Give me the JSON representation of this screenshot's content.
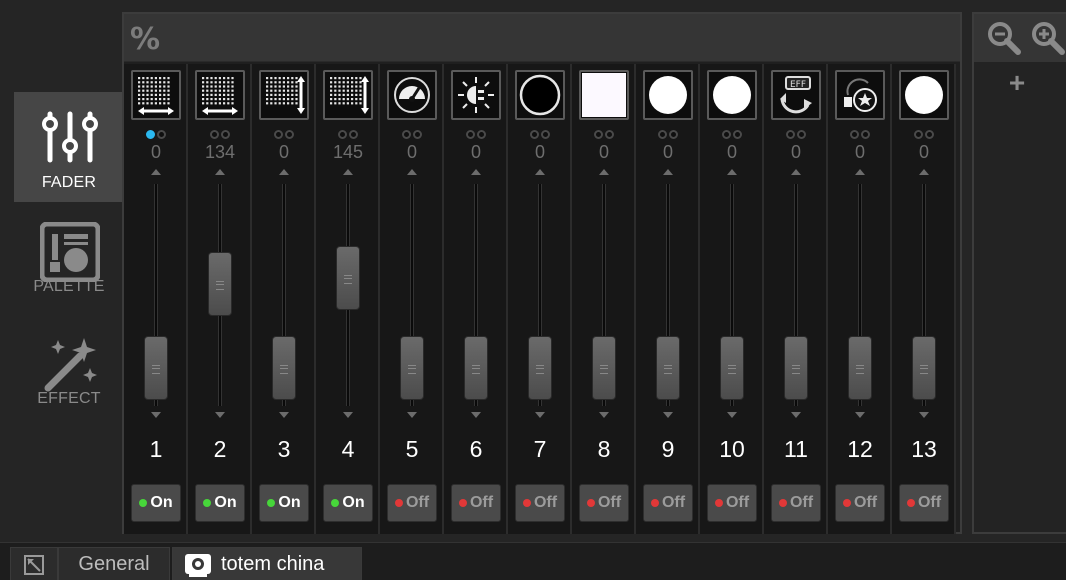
{
  "modes": [
    {
      "id": "fader",
      "label": "FADER",
      "active": true,
      "icon": "sliders-icon"
    },
    {
      "id": "palette",
      "label": "PALETTE",
      "active": false,
      "icon": "palette-icon"
    },
    {
      "id": "effect",
      "label": "EFFECT",
      "active": false,
      "icon": "magic-wand-icon"
    }
  ],
  "panel": {
    "header_icon": "percent-icon"
  },
  "strips": [
    {
      "number": "1",
      "value": "0",
      "fader_level": 0,
      "thumb": "grid-horizontal-icon",
      "dot_active": true,
      "state": "On"
    },
    {
      "number": "2",
      "value": "134",
      "fader_level": 0.53,
      "thumb": "grid-horizontal-icon",
      "dot_active": false,
      "state": "On"
    },
    {
      "number": "3",
      "value": "0",
      "fader_level": 0,
      "thumb": "grid-vertical-icon",
      "dot_active": false,
      "state": "On"
    },
    {
      "number": "4",
      "value": "145",
      "fader_level": 0.57,
      "thumb": "grid-vertical-icon",
      "dot_active": false,
      "state": "On"
    },
    {
      "number": "5",
      "value": "0",
      "fader_level": 0,
      "thumb": "dimmer-gauge-icon",
      "dot_active": false,
      "state": "Off"
    },
    {
      "number": "6",
      "value": "0",
      "fader_level": 0,
      "thumb": "shutter-icon",
      "dot_active": false,
      "state": "Off"
    },
    {
      "number": "7",
      "value": "0",
      "fader_level": 0,
      "thumb": "color-black-icon",
      "dot_active": false,
      "state": "Off"
    },
    {
      "number": "8",
      "value": "0",
      "fader_level": 0,
      "thumb": "color-white-square-icon",
      "dot_active": false,
      "state": "Off"
    },
    {
      "number": "9",
      "value": "0",
      "fader_level": 0,
      "thumb": "color-white-circle-icon",
      "dot_active": false,
      "state": "Off"
    },
    {
      "number": "10",
      "value": "0",
      "fader_level": 0,
      "thumb": "color-white-circle-icon",
      "dot_active": false,
      "state": "Off"
    },
    {
      "number": "11",
      "value": "0",
      "fader_level": 0,
      "thumb": "effect-rotate-icon",
      "dot_active": false,
      "state": "Off"
    },
    {
      "number": "12",
      "value": "0",
      "fader_level": 0,
      "thumb": "gobo-star-icon",
      "dot_active": false,
      "state": "Off"
    },
    {
      "number": "13",
      "value": "0",
      "fader_level": 0,
      "thumb": "color-white-circle-icon",
      "dot_active": false,
      "state": "Off"
    }
  ],
  "zoom": {
    "out_icon": "zoom-out-icon",
    "in_icon": "zoom-in-icon",
    "add_label": "+"
  },
  "tabs": [
    {
      "label": "",
      "icon": "expand-icon"
    },
    {
      "label": "General",
      "icon": ""
    },
    {
      "label": "totem china",
      "icon": "fixture-icon",
      "active": true
    }
  ],
  "colors": {
    "accent": "#2bb8ef",
    "on_led": "#47d63a",
    "off_led": "#e23838"
  }
}
